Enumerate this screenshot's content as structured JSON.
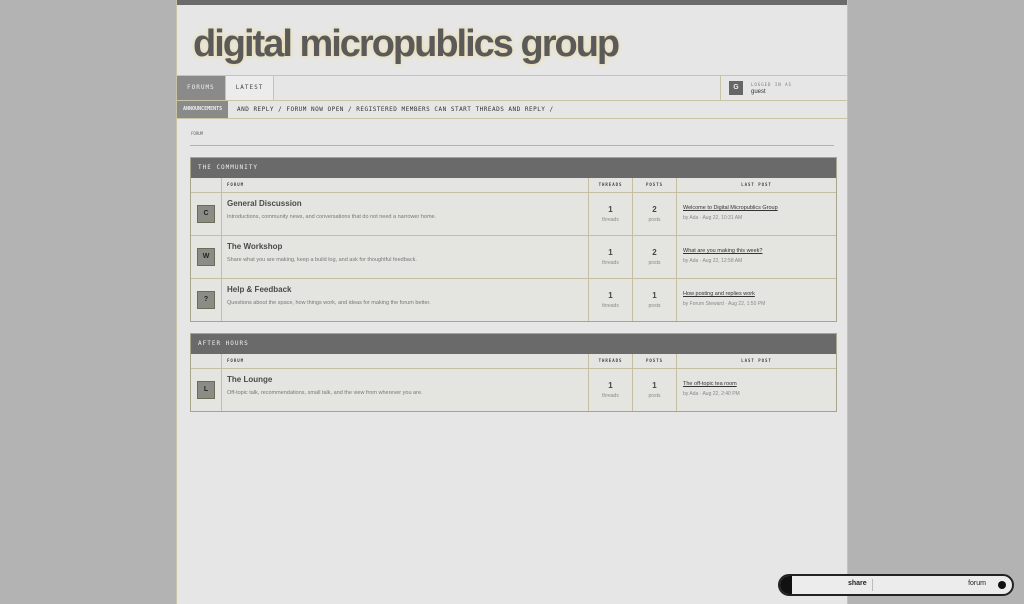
{
  "site": {
    "title": "digital micropublics group"
  },
  "nav": {
    "tabs": [
      {
        "label": "FORUMS"
      },
      {
        "label": "LATEST"
      }
    ]
  },
  "user": {
    "avatar_letter": "G",
    "logged_in_label": "LOGGED IN AS",
    "name": "guest"
  },
  "ticker": {
    "label": "ANNOUNCEMENTS",
    "text": "AND REPLY /       FORUM NOW OPEN / REGISTERED MEMBERS CAN START THREADS AND REPLY /"
  },
  "breadcrumb": "FORUM",
  "columns": {
    "forum": "FORUM",
    "threads": "THREADS",
    "posts": "POSTS",
    "last_post": "LAST POST"
  },
  "categories": [
    {
      "title": "THE COMMUNITY",
      "forums": [
        {
          "letter": "C",
          "name": "General Discussion",
          "desc": "Introductions, community news, and conversations that do not need a narrower home.",
          "threads": "1",
          "threads_label": "threads",
          "posts": "2",
          "posts_label": "posts",
          "last_title": "Welcome to Digital Micropublics Group",
          "last_meta": "by Ada · Aug 22, 10:31 AM"
        },
        {
          "letter": "W",
          "name": "The Workshop",
          "desc": "Share what you are making, keep a build log, and ask for thoughtful feedback.",
          "threads": "1",
          "threads_label": "threads",
          "posts": "2",
          "posts_label": "posts",
          "last_title": "What are you making this week?",
          "last_meta": "by Ada · Aug 22, 12:58 AM"
        },
        {
          "letter": "?",
          "name": "Help & Feedback",
          "desc": "Questions about the space, how things work, and ideas for making the forum better.",
          "threads": "1",
          "threads_label": "threads",
          "posts": "1",
          "posts_label": "posts",
          "last_title": "How posting and replies work",
          "last_meta": "by Forum Steward · Aug 22, 1:50 PM"
        }
      ]
    },
    {
      "title": "AFTER HOURS",
      "forums": [
        {
          "letter": "L",
          "name": "The Lounge",
          "desc": "Off-topic talk, recommendations, small talk, and the view from wherever you are.",
          "threads": "1",
          "threads_label": "threads",
          "posts": "1",
          "posts_label": "posts",
          "last_title": "The off-topic tea room",
          "last_meta": "by Ada · Aug 22, 2:40 PM"
        }
      ]
    }
  ],
  "sharebar": {
    "share_label": "share",
    "forum_label": "forum"
  }
}
